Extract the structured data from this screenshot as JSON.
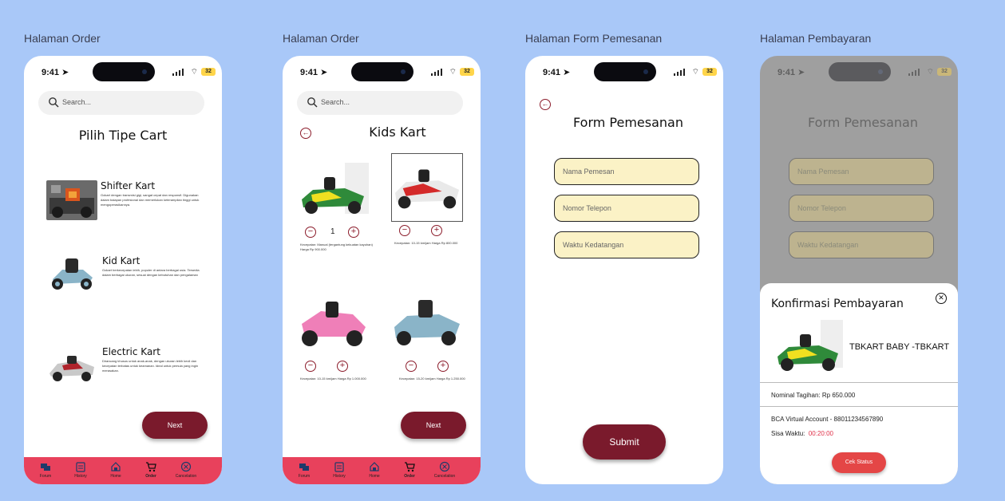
{
  "labels": {
    "frame1": "Halaman Order",
    "frame2": "Halaman Order",
    "frame3": "Halaman Form Pemesanan",
    "frame4": "Halaman Pembayaran"
  },
  "status": {
    "time": "9:41",
    "battery": "32"
  },
  "search": {
    "placeholder": "Search..."
  },
  "nav": {
    "items": [
      {
        "label": "Forum",
        "icon": "forum-icon"
      },
      {
        "label": "History",
        "icon": "history-icon"
      },
      {
        "label": "Home",
        "icon": "home-icon"
      },
      {
        "label": "Order",
        "icon": "cart-icon",
        "active": true
      },
      {
        "label": "Cancelation",
        "icon": "cancel-icon"
      }
    ]
  },
  "screen1": {
    "title": "Pilih Tipe Cart",
    "carts": [
      {
        "name": "Shifter Kart",
        "desc": "Gokart dengan transmisi gigi, sangat cepat dan responsif. Digunakan dalam balapan profesional dan memerlukan keterampilan tinggi untuk mengoperasikannya."
      },
      {
        "name": "Kid Kart",
        "desc": "Gokart berkecepatan lebih, populer di antara berbagai usia. Tersedia dalam berbagai ukuran, sesuai dengan kebutuhan dan pengalaman"
      },
      {
        "name": "Electric Kart",
        "desc": "Dirancang khusus untuk anak-anak, dengan ukuran lebih kecil dan kecepatan terbatas untuk keamanan. Ideal untuk pemula yang ingin merasakan."
      }
    ],
    "next": "Next"
  },
  "screen2": {
    "title": "Kids Kart",
    "karts": [
      {
        "qty": "1",
        "info": "Kecepatan: Manual (tergantung kekuatan kayuhan) Harga Rp 900.000"
      },
      {
        "qty": "",
        "info": "Kecepatan: 10-15 km/jam Harga Rp 800.000"
      },
      {
        "qty": "",
        "info": "Kecepatan: 10-15 km/jam Harga Rp 1.000.000"
      },
      {
        "qty": "",
        "info": "Kecepatan: 15-20 km/jam Harga Rp 1.250.000"
      }
    ],
    "next": "Next"
  },
  "screen3": {
    "title": "Form Pemesanan",
    "fields": [
      "Nama Pemesan",
      "Nomor Telepon",
      "Waktu Kedatangan"
    ],
    "submit": "Submit"
  },
  "screen4": {
    "bg_title": "Form Pemesanan",
    "bg_fields": [
      "Nama Pemesan",
      "Nomor Telepon",
      "Waktu Kedatangan"
    ],
    "sheet": {
      "title": "Konfirmasi Pembayaran",
      "product": "TBKART BABY -TBKART",
      "nominal_label": "Nominal Tagihan: Rp",
      "nominal_value": "650.000",
      "va_label": "BCA Virtual Account - 88011234567890",
      "timer_label": "Sisa Waktu:",
      "timer_value": "00:20:00",
      "button": "Cek Status"
    }
  },
  "colors": {
    "background": "#a9c8f8",
    "primary": "#7a1a2c",
    "tabbar": "#e8415c",
    "field": "#fbf2c6",
    "cek": "#e44646"
  }
}
